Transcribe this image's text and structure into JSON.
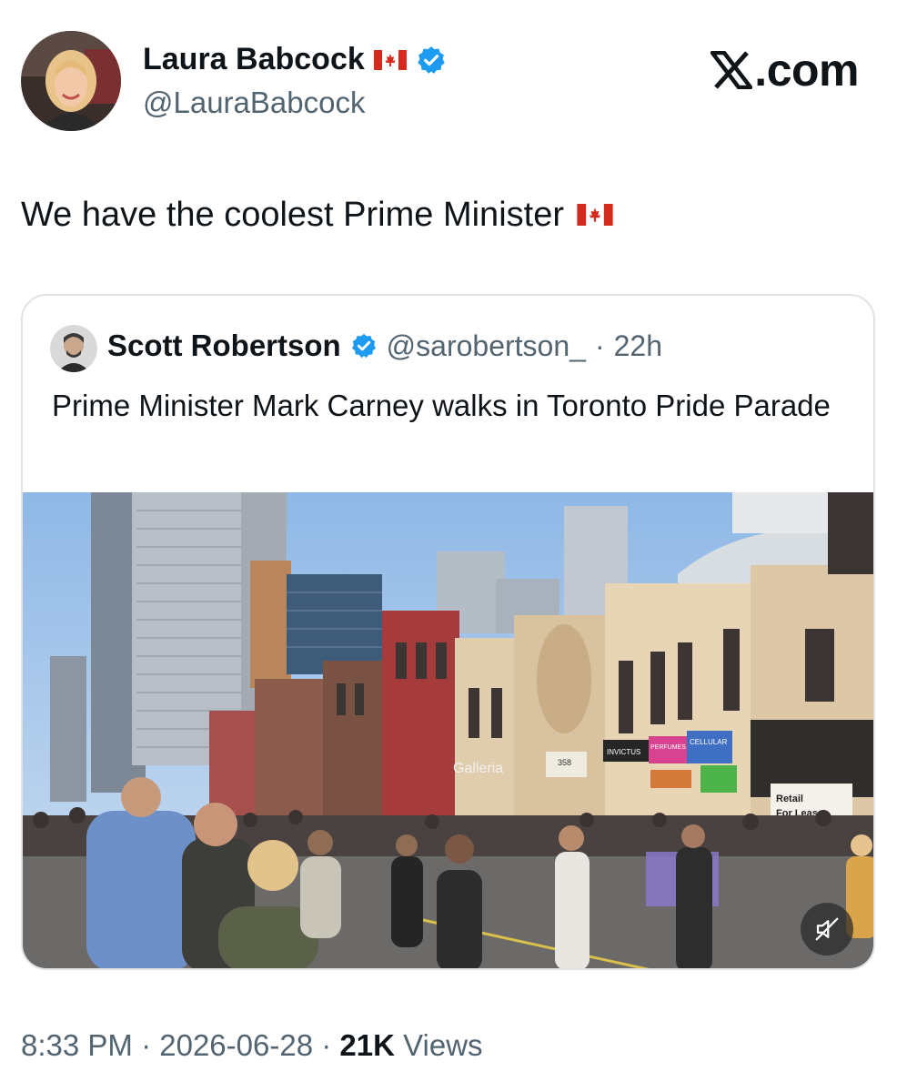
{
  "site": {
    "brand": "X.com"
  },
  "tweet": {
    "author": {
      "name": "Laura Babcock",
      "handle": "@LauraBabcock",
      "flag_icon": "canada-flag-icon",
      "verified": true
    },
    "text": "We have the coolest Prime Minister",
    "text_flag_icon": "canada-flag-icon",
    "time": "8:33 PM",
    "date": "2026-06-28",
    "views_count": "21K",
    "views_label": "Views",
    "separator": "·"
  },
  "quoted": {
    "author": {
      "name": "Scott Robertson",
      "handle": "@sarobertson_",
      "verified": true
    },
    "age": "22h",
    "separator": "·",
    "text": "Prime Minister Mark Carney walks in Toronto Pride Parade",
    "media": {
      "type": "video",
      "muted": true,
      "signs": {
        "gallery": "Galleria",
        "retail": [
          "Retail",
          "For Lease"
        ],
        "invictus": "INVICTUS",
        "perfumes": "PERFUMES",
        "cellular": "CELLULAR",
        "number": "358"
      }
    }
  },
  "colors": {
    "verified": "#1d9bf0",
    "secondary_text": "#536471",
    "canada_red": "#d52b1e"
  }
}
